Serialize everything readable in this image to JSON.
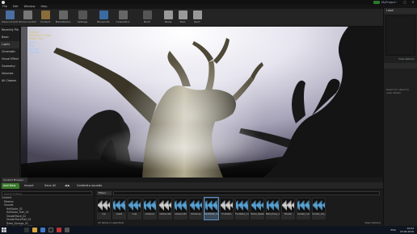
{
  "window": {
    "project": "MyProject"
  },
  "menu": [
    "File",
    "Edit",
    "Window",
    "Help"
  ],
  "toolbar": {
    "buttons": [
      {
        "label": "Save Current",
        "icon": "save-icon",
        "color": "#4a6fa0"
      },
      {
        "label": "Source Control",
        "icon": "source-control-icon",
        "color": "#777"
      },
      {
        "label": "Content",
        "icon": "content-icon",
        "color": "#8a6d3b"
      },
      {
        "label": "Marketplace",
        "icon": "marketplace-icon",
        "color": "#666"
      },
      {
        "label": "Settings",
        "icon": "settings-icon",
        "color": "#555"
      },
      {
        "label": "Blueprints",
        "icon": "blueprints-icon",
        "color": "#3a6aa0"
      },
      {
        "label": "Cinematics",
        "icon": "cinematics-icon",
        "color": "#666"
      },
      {
        "label": "Build",
        "icon": "build-icon",
        "color": "#555"
      },
      {
        "label": "Pause",
        "icon": "pause-icon",
        "color": "#999"
      },
      {
        "label": "Stop",
        "icon": "stop-icon",
        "color": "#999"
      },
      {
        "label": "Eject",
        "icon": "eject-icon",
        "color": "#999"
      }
    ]
  },
  "left_panel": {
    "items": [
      "Recently Pla",
      "Basic",
      "Lights",
      "Cinematic",
      "Visual Effect",
      "Geometry",
      "Volumes",
      "All Classes"
    ]
  },
  "viewport": {
    "overlay_lines": [
      "Camera",
      "Selection 0 Offset",
      "Game View",
      "None",
      "Play",
      "Possess",
      "Simulate"
    ]
  },
  "right_panel": {
    "header": "Label",
    "view_options": "View Options",
    "empty_message": "Select an object to view details"
  },
  "content_browser": {
    "tab": "Content Browser",
    "add_new": "Add New",
    "import": "Import",
    "save_all": "Save All",
    "breadcrumb": [
      "Content",
      "sounds"
    ],
    "filters": "Filters",
    "search_placeholder": "Search sounds",
    "tree_search_placeholder": "Search Folders",
    "tree": [
      "Content",
      "Meshes",
      "Sounds",
      "HellVoice_02",
      "HellVoice_Trail_02",
      "SmokeTrace_02",
      "SmokeTraceTrail_02",
      "Trees_Stumps_01",
      "VegetationTrees_005"
    ],
    "tree_footer": "Lvl Content",
    "assets": [
      {
        "name": "Cue",
        "sel": false
      },
      {
        "name": "Cue02",
        "sel": false
      },
      {
        "name": "Cues",
        "sel": false
      },
      {
        "name": "Ambience",
        "sel": false
      },
      {
        "name": "Ambience02",
        "sel": false
      },
      {
        "name": "Ambience03",
        "sel": false
      },
      {
        "name": "DarkGroup",
        "sel": false
      },
      {
        "name": "DarkMaster_Voice",
        "sel": true
      },
      {
        "name": "FrontalRun",
        "sel": false
      },
      {
        "name": "FrontalRun_Cue",
        "sel": false
      },
      {
        "name": "Hollow_Dwellers",
        "sel": false
      },
      {
        "name": "Metal_Heavy_Impact",
        "sel": false
      },
      {
        "name": "Monster",
        "sel": false
      },
      {
        "name": "monster_roar",
        "sel": false
      },
      {
        "name": "monster_roar_cue",
        "sel": false
      }
    ],
    "count": "15 items (1 selected)",
    "view_options": "View Options"
  },
  "taskbar": {
    "time": "10:03",
    "date": "23.09.2016",
    "lang": "ENG"
  }
}
